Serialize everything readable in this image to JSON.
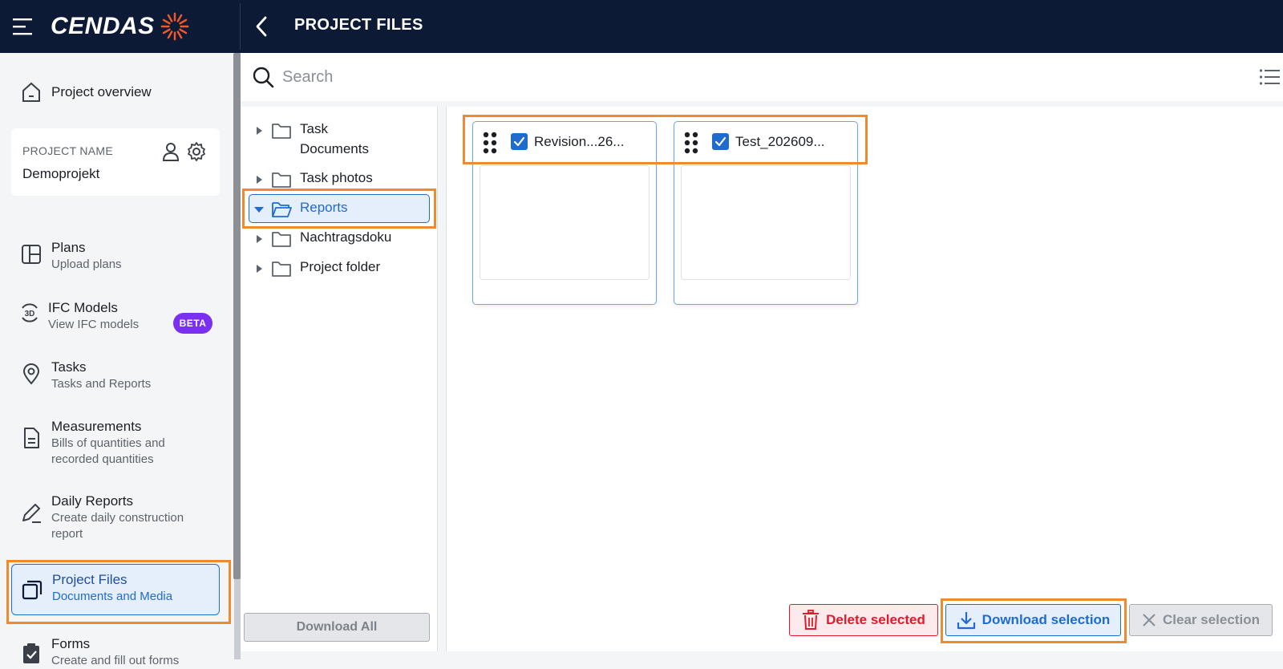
{
  "header": {
    "logo_text": "CENDAS",
    "title": "PROJECT FILES"
  },
  "sidebar": {
    "overview": "Project overview",
    "project_label": "PROJECT NAME",
    "project_name": "Demoprojekt",
    "items": [
      {
        "title": "Plans",
        "sub": "Upload plans"
      },
      {
        "title": "IFC Models",
        "sub": "View IFC models",
        "badge": "BETA"
      },
      {
        "title": "Tasks",
        "sub": "Tasks and Reports"
      },
      {
        "title": "Measurements",
        "sub": "Bills of quantities and recorded quantities"
      },
      {
        "title": "Daily Reports",
        "sub": "Create daily construction report"
      },
      {
        "title": "Project Files",
        "sub": "Documents and Media"
      },
      {
        "title": "Forms",
        "sub": "Create and fill out forms"
      }
    ]
  },
  "search": {
    "placeholder": "Search"
  },
  "tree": {
    "folders": [
      {
        "label": "Task Documents"
      },
      {
        "label": "Task photos"
      },
      {
        "label": "Reports"
      },
      {
        "label": "Nachtragsdoku"
      },
      {
        "label": "Project folder"
      }
    ],
    "download_all": "Download All"
  },
  "files": [
    {
      "name": "Revision...26...",
      "checked": true
    },
    {
      "name": "Test_202609...",
      "checked": true
    }
  ],
  "actions": {
    "delete": "Delete selected",
    "download": "Download selection",
    "clear": "Clear selection"
  },
  "colors": {
    "topbar": "#0c1a36",
    "accent": "#1f6ccf",
    "danger": "#e3192e",
    "badge": "#7b2ff0",
    "highlight": "#f08a2e"
  }
}
